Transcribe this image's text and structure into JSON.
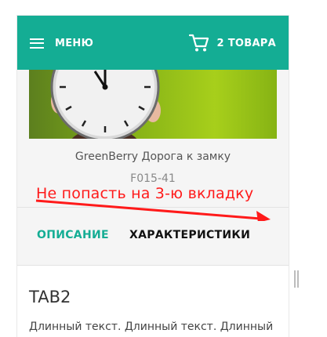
{
  "header": {
    "menu_label": "МЕНЮ",
    "cart_label": "2 ТОВАРА",
    "colors": {
      "topbar": "#14ad94",
      "text": "#ffffff"
    }
  },
  "product": {
    "title": "GreenBerry Дорога к замку",
    "code": "F015-41"
  },
  "annotation": {
    "text": "Не попасть на 3-ю вкладку",
    "color": "#ff1a1a"
  },
  "tabs": [
    {
      "label": "ОПИСАНИЕ",
      "active": false
    },
    {
      "label": "ХАРАКТЕРИСТИКИ",
      "active": true
    }
  ],
  "tab_content": {
    "heading": "TAB2",
    "text": "Длинный текст. Длинный текст. Длинный"
  },
  "icons": [
    "hamburger-icon",
    "cart-icon",
    "wall-clock",
    "red-arrow",
    "scroll-grip-icon"
  ]
}
